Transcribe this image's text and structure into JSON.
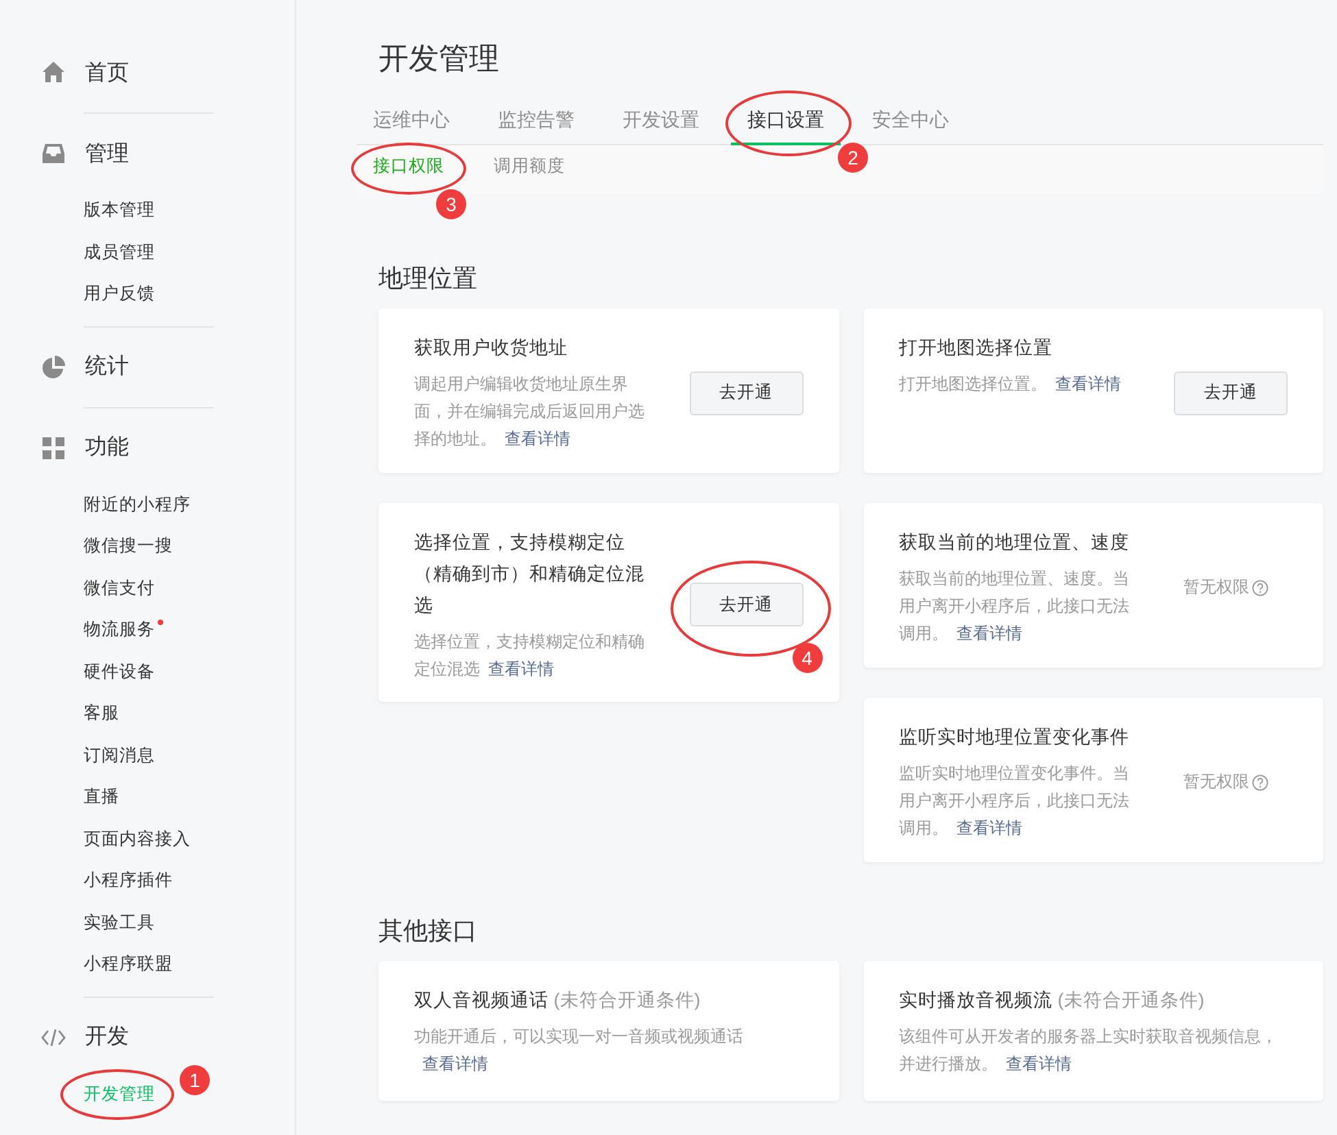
{
  "sidebar": {
    "groups": [
      {
        "label": "首页"
      },
      {
        "label": "管理",
        "items": [
          {
            "label": "版本管理",
            "selected": false
          },
          {
            "label": "成员管理",
            "selected": false
          },
          {
            "label": "用户反馈",
            "selected": false
          }
        ]
      },
      {
        "label": "统计"
      },
      {
        "label": "功能",
        "items": [
          {
            "label": "附近的小程序",
            "selected": false
          },
          {
            "label": "微信搜一搜",
            "selected": false
          },
          {
            "label": "微信支付",
            "selected": false
          },
          {
            "label": "物流服务",
            "selected": false,
            "dot": true
          },
          {
            "label": "硬件设备",
            "selected": false
          },
          {
            "label": "客服",
            "selected": false
          },
          {
            "label": "订阅消息",
            "selected": false
          },
          {
            "label": "直播",
            "selected": false
          },
          {
            "label": "页面内容接入",
            "selected": false
          },
          {
            "label": "小程序插件",
            "selected": false
          },
          {
            "label": "实验工具",
            "selected": false
          },
          {
            "label": "小程序联盟",
            "selected": false
          }
        ]
      },
      {
        "label": "开发",
        "items": [
          {
            "label": "开发管理",
            "selected": true,
            "annotation": "1"
          }
        ]
      }
    ]
  },
  "page_title": "开发管理",
  "tabs": [
    {
      "label": "运维中心",
      "selected": false
    },
    {
      "label": "监控告警",
      "selected": false
    },
    {
      "label": "开发设置",
      "selected": false
    },
    {
      "label": "接口设置",
      "selected": true,
      "annotation": "2"
    },
    {
      "label": "安全中心",
      "selected": false
    }
  ],
  "subtabs": [
    {
      "label": "接口权限",
      "selected": true,
      "annotation": "3"
    },
    {
      "label": "调用额度",
      "selected": false
    }
  ],
  "sections": [
    {
      "title": "地理位置",
      "columns": [
        [
          {
            "title": "获取用户收货地址",
            "description": "调起用户编辑收货地址原生界面，并在编辑完成后返回用户选择的地址。",
            "link": "查看详情",
            "action": {
              "kind": "button",
              "label": "去开通"
            }
          },
          {
            "title": "选择位置，支持模糊定位（精确到市）和精确定位混选",
            "description": "选择位置，支持模糊定位和精确定位混选",
            "link": "查看详情",
            "action": {
              "kind": "button",
              "label": "去开通",
              "annotation": "4"
            }
          }
        ],
        [
          {
            "title": "打开地图选择位置",
            "description": "打开地图选择位置。",
            "link": "查看详情",
            "action": {
              "kind": "button",
              "label": "去开通"
            }
          },
          {
            "title": "获取当前的地理位置、速度",
            "description": "获取当前的地理位置、速度。当用户离开小程序后，此接口无法调用。",
            "link": "查看详情",
            "action": {
              "kind": "status",
              "label": "暂无权限"
            }
          },
          {
            "title": "监听实时地理位置变化事件",
            "description": "监听实时地理位置变化事件。当用户离开小程序后，此接口无法调用。",
            "link": "查看详情",
            "action": {
              "kind": "status",
              "label": "暂无权限"
            }
          }
        ]
      ]
    },
    {
      "title": "其他接口",
      "columns": [
        [
          {
            "title": "双人音视频通话",
            "note": "(未符合开通条件)",
            "description": "功能开通后，可以实现一对一音频或视频通话",
            "link": "查看详情"
          }
        ],
        [
          {
            "title": "实时播放音视频流",
            "note": "(未符合开通条件)",
            "description": "该组件可从开发者的服务器上实时获取音视频信息，并进行播放。",
            "link": "查看详情"
          }
        ]
      ]
    }
  ]
}
